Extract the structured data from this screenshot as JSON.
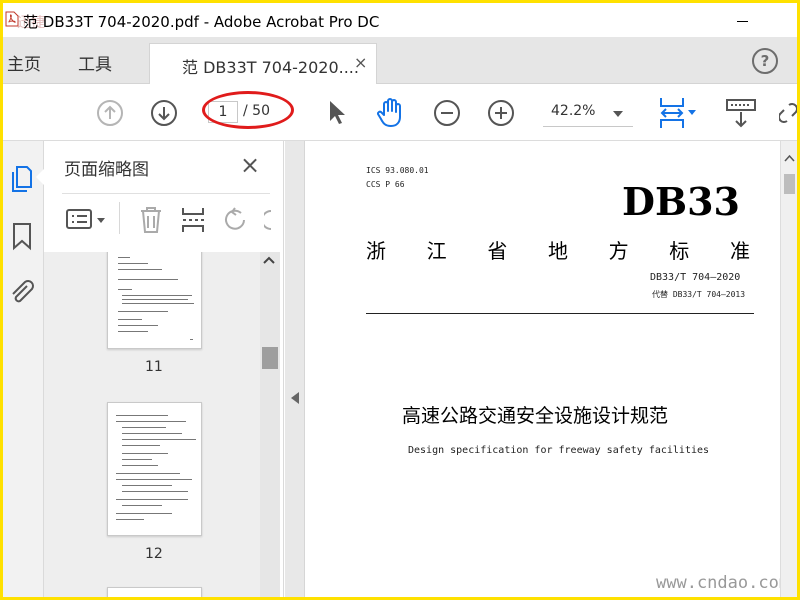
{
  "window": {
    "title": "范 DB33T 704-2020.pdf - Adobe Acrobat Pro DC",
    "watermark_top": "迅捷",
    "minimize_glyph": "–"
  },
  "tabs": {
    "home": "主页",
    "tools": "工具",
    "document": "范 DB33T 704-2020....",
    "close_glyph": "×",
    "help_glyph": "?"
  },
  "toolbar": {
    "page_current": "1",
    "page_total": "/ 50",
    "zoom": "42.2%",
    "icons": [
      "prev-page-icon",
      "next-page-icon",
      "select-cursor-icon",
      "hand-tool-icon",
      "zoom-out-icon",
      "zoom-in-icon",
      "fit-page-icon",
      "download-icon",
      "link-icon"
    ],
    "highlight_color": "#e01b1b"
  },
  "left_rail": {
    "icons": [
      "page-thumbnails-icon",
      "bookmarks-icon",
      "attachments-icon"
    ],
    "accent": "#1473e6"
  },
  "thumbnail_panel": {
    "title": "页面缩略图",
    "close_glyph": "×",
    "pages": [
      {
        "number": "11"
      },
      {
        "number": "12"
      }
    ]
  },
  "document": {
    "ics": "ICS 93.080.01",
    "ccs": "CCS P 66",
    "code": "DB33",
    "standard_type": [
      "浙",
      "江",
      "省",
      "地",
      "方",
      "标",
      "准"
    ],
    "number": "DB33/T 704—2020",
    "replaces": "代替 DB33/T 704—2013",
    "title_cn": "高速公路交通安全设施设计规范",
    "title_en": "Design specification for freeway safety facilities",
    "watermark": "www.cndao.com"
  }
}
